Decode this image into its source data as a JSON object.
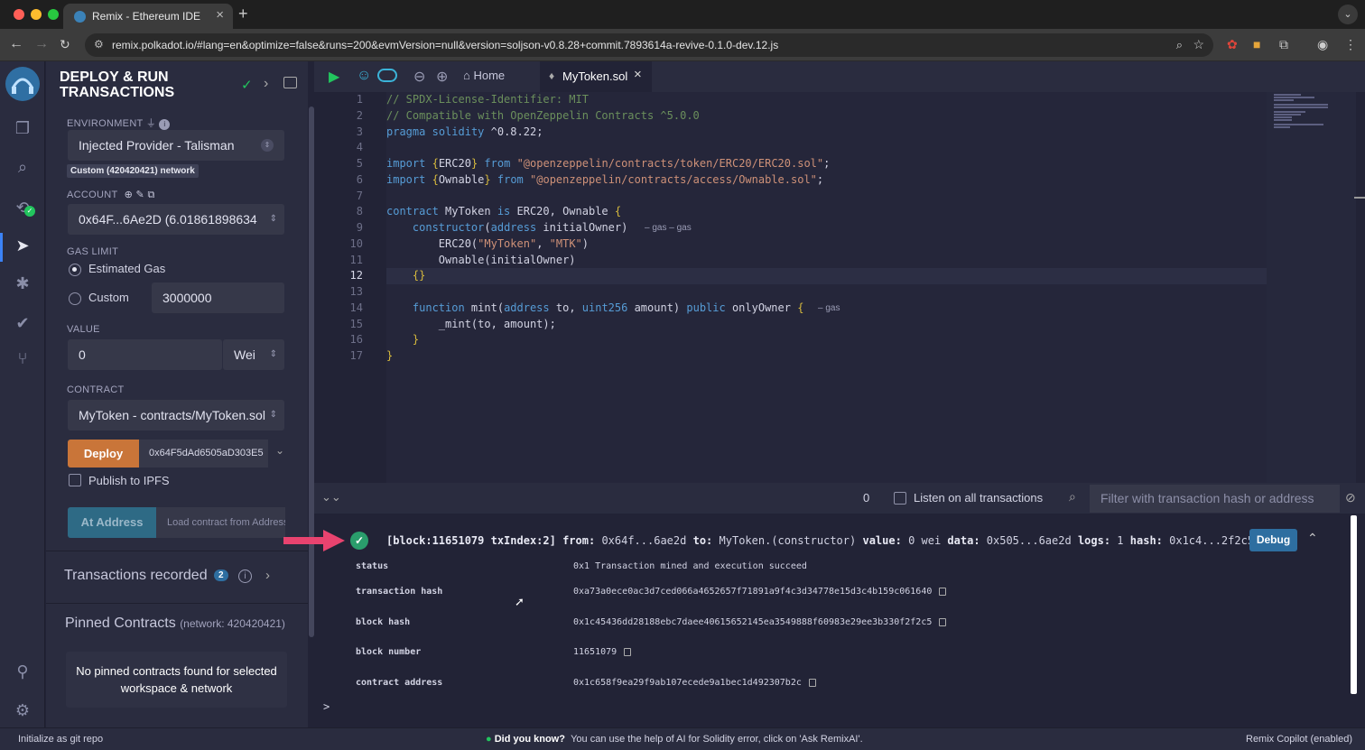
{
  "browser": {
    "tab_title": "Remix - Ethereum IDE",
    "url": "remix.polkadot.io/#lang=en&optimize=false&runs=200&evmVersion=null&version=soljson-v0.8.28+commit.7893614a-revive-0.1.0-dev.12.js"
  },
  "panel": {
    "title": "DEPLOY & RUN TRANSACTIONS",
    "environment_label": "ENVIRONMENT",
    "environment_value": "Injected Provider - Talisman",
    "network_badge": "Custom (420420421) network",
    "account_label": "ACCOUNT",
    "account_value": "0x64F...6Ae2D (6.01861898634",
    "gas_limit_label": "GAS LIMIT",
    "estimated_gas": "Estimated Gas",
    "custom_gas": "Custom",
    "gas_value": "3000000",
    "value_label": "VALUE",
    "value_amount": "0",
    "value_unit": "Wei",
    "contract_label": "CONTRACT",
    "contract_value": "MyToken - contracts/MyToken.sol",
    "deploy_label": "Deploy",
    "deploy_arg": "0x64F5dAd6505aD303E5",
    "publish_ipfs": "Publish to IPFS",
    "at_address_label": "At Address",
    "at_address_placeholder": "Load contract from Address",
    "transactions_recorded": "Transactions recorded",
    "transactions_count": "2",
    "pinned_title": "Pinned Contracts",
    "pinned_network": "(network: 420420421)",
    "no_pinned": "No pinned contracts found for selected workspace & network"
  },
  "editor": {
    "home_tab": "Home",
    "file_tab": "MyToken.sol",
    "lines": [
      "// SPDX-License-Identifier: MIT",
      "// Compatible with OpenZeppelin Contracts ^5.0.0",
      "pragma solidity ^0.8.22;",
      "",
      "import {ERC20} from \"@openzeppelin/contracts/token/ERC20/ERC20.sol\";",
      "import {Ownable} from \"@openzeppelin/contracts/access/Ownable.sol\";",
      "",
      "contract MyToken is ERC20, Ownable {",
      "    constructor(address initialOwner)",
      "        ERC20(\"MyToken\", \"MTK\")",
      "        Ownable(initialOwner)",
      "    {}",
      "",
      "    function mint(address to, uint256 amount) public onlyOwner {",
      "        _mint(to, amount);",
      "    }",
      "}"
    ],
    "line_numbers": [
      "1",
      "2",
      "3",
      "4",
      "5",
      "6",
      "7",
      "8",
      "9",
      "10",
      "11",
      "12",
      "13",
      "14",
      "15",
      "16",
      "17"
    ],
    "gas_hint_constructor": "– gas – gas",
    "gas_hint_mint": "– gas"
  },
  "terminal": {
    "pending_count": "0",
    "listen_label": "Listen on all transactions",
    "filter_placeholder": "Filter with transaction hash or address",
    "tx_summary": {
      "block": "[block:11651079 txIndex:2]",
      "from_label": "from:",
      "from": "0x64f...6ae2d",
      "to_label": "to:",
      "to": "MyToken.(constructor)",
      "value_label": "value:",
      "value": "0 wei",
      "data_label": "data:",
      "data": "0x505...6ae2d",
      "logs_label": "logs:",
      "logs": "1",
      "hash_label": "hash:",
      "hash": "0x1c4...2f2c5"
    },
    "debug_label": "Debug",
    "details": [
      {
        "key": "status",
        "value": "0x1 Transaction mined and execution succeed"
      },
      {
        "key": "transaction hash",
        "value": "0xa73a0ece0ac3d7ced066a4652657f71891a9f4c3d34778e15d3c4b159c061640"
      },
      {
        "key": "block hash",
        "value": "0x1c45436dd28188ebc7daee40615652145ea3549888f60983e29ee3b330f2f2c5"
      },
      {
        "key": "block number",
        "value": "11651079"
      },
      {
        "key": "contract address",
        "value": "0x1c658f9ea29f9ab107ecede9a1bec1d492307b2c"
      }
    ],
    "prompt": ">"
  },
  "statusbar": {
    "left": "Initialize as git repo",
    "tip_title": "Did you know?",
    "tip_text": "You can use the help of AI for Solidity error, click on 'Ask RemixAI'.",
    "right": "Remix Copilot (enabled)"
  },
  "colors": {
    "deploy": "#c97539",
    "accent": "#2e6ea0",
    "success": "#2a9d6c",
    "annotation_arrow": "#e8436f"
  }
}
